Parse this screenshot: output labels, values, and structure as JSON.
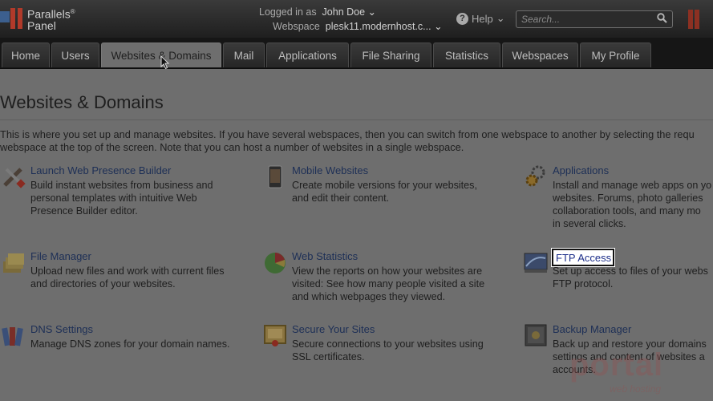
{
  "brand": {
    "name_line1": "Parallels",
    "registered": "®",
    "name_line2": "Panel"
  },
  "header": {
    "logged_in_label": "Logged in as",
    "user_name": "John Doe",
    "webspace_label": "Webspace",
    "webspace_value": "plesk11.modernhost.c...",
    "help_label": "Help"
  },
  "search": {
    "placeholder": "Search..."
  },
  "tabs": [
    {
      "label": "Home"
    },
    {
      "label": "Users"
    },
    {
      "label": "Websites & Domains"
    },
    {
      "label": "Mail"
    },
    {
      "label": "Applications"
    },
    {
      "label": "File Sharing"
    },
    {
      "label": "Statistics"
    },
    {
      "label": "Webspaces"
    },
    {
      "label": "My Profile"
    }
  ],
  "page": {
    "title": "Websites & Domains",
    "intro_line1": "This is where you set up and manage websites. If you have several webspaces, then you can switch from one webspace to another by selecting the requ",
    "intro_line2": "webspace at the top of the screen. Note that you can host a number of websites in a single webspace."
  },
  "items": [
    {
      "title": "Launch Web Presence Builder",
      "lines": [
        "Build instant websites from business and",
        "personal templates with intuitive Web",
        "Presence Builder editor."
      ],
      "icon": "wrench-icon"
    },
    {
      "title": "Mobile Websites",
      "lines": [
        "Create mobile versions for your websites,",
        "and edit their content."
      ],
      "icon": "mobile-icon"
    },
    {
      "title": "Applications",
      "lines": [
        "Install and manage web apps on yo",
        "websites. Forums, photo galleries",
        "collaboration tools, and many mo",
        "in several clicks."
      ],
      "icon": "gears-icon"
    },
    {
      "title": "File Manager",
      "lines": [
        "Upload new files and work with current files",
        "and directories of your websites."
      ],
      "icon": "folders-icon"
    },
    {
      "title": "Web Statistics",
      "lines": [
        "View the reports on how your websites are",
        "visited: See how many people visited a site",
        "and which webpages they viewed."
      ],
      "icon": "pie-chart-icon"
    },
    {
      "title": "FTP Access",
      "lines": [
        "Set up access to files of your webs",
        "FTP protocol."
      ],
      "icon": "ftp-icon"
    },
    {
      "title": "DNS Settings",
      "lines": [
        "Manage DNS zones for your domain names."
      ],
      "icon": "books-icon"
    },
    {
      "title": "Secure Your Sites",
      "lines": [
        "Secure connections to your websites using",
        "SSL certificates."
      ],
      "icon": "certificate-icon"
    },
    {
      "title": "Backup Manager",
      "lines": [
        "Back up and restore your domains",
        "settings and content of websites a",
        "accounts."
      ],
      "icon": "safe-icon"
    }
  ],
  "watermark": {
    "text": "portal",
    "subtext": "web hosting"
  },
  "colors": {
    "header_bg": "#1f1f1f",
    "link": "#1d2f56",
    "page_bg": "#6e6e6e",
    "brand_red": "#b13a2a"
  }
}
